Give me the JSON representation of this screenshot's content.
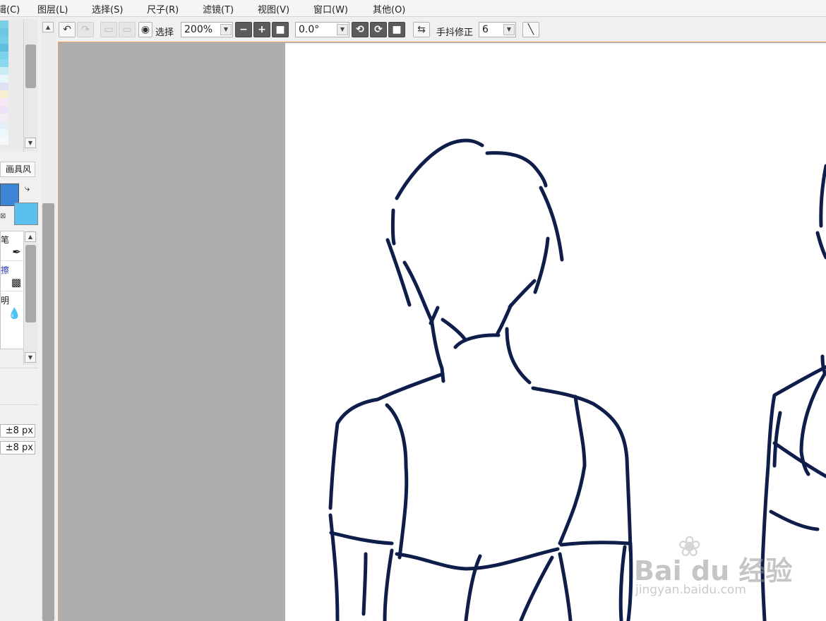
{
  "menu": [
    "辑(C)",
    "图层(L)",
    "选择(S)",
    "尺子(R)",
    "滤镜(T)",
    "视图(V)",
    "窗口(W)",
    "其他(O)"
  ],
  "left_panel": {
    "tab_label": "画具风",
    "tools": [
      "笔",
      "擦",
      "明"
    ],
    "offset_x": "±8 px",
    "offset_y": "±8 px",
    "main_color": "#3d86d6",
    "sub_color": "#5bc0ee"
  },
  "toolbar": {
    "select_label": "选择",
    "zoom": "200%",
    "rotation": "0.0°",
    "stabilizer_label": "手抖修正",
    "stabilizer_value": "6"
  },
  "watermark": {
    "brand": "Bai du 经验",
    "url": "jingyan.baidu.com"
  }
}
